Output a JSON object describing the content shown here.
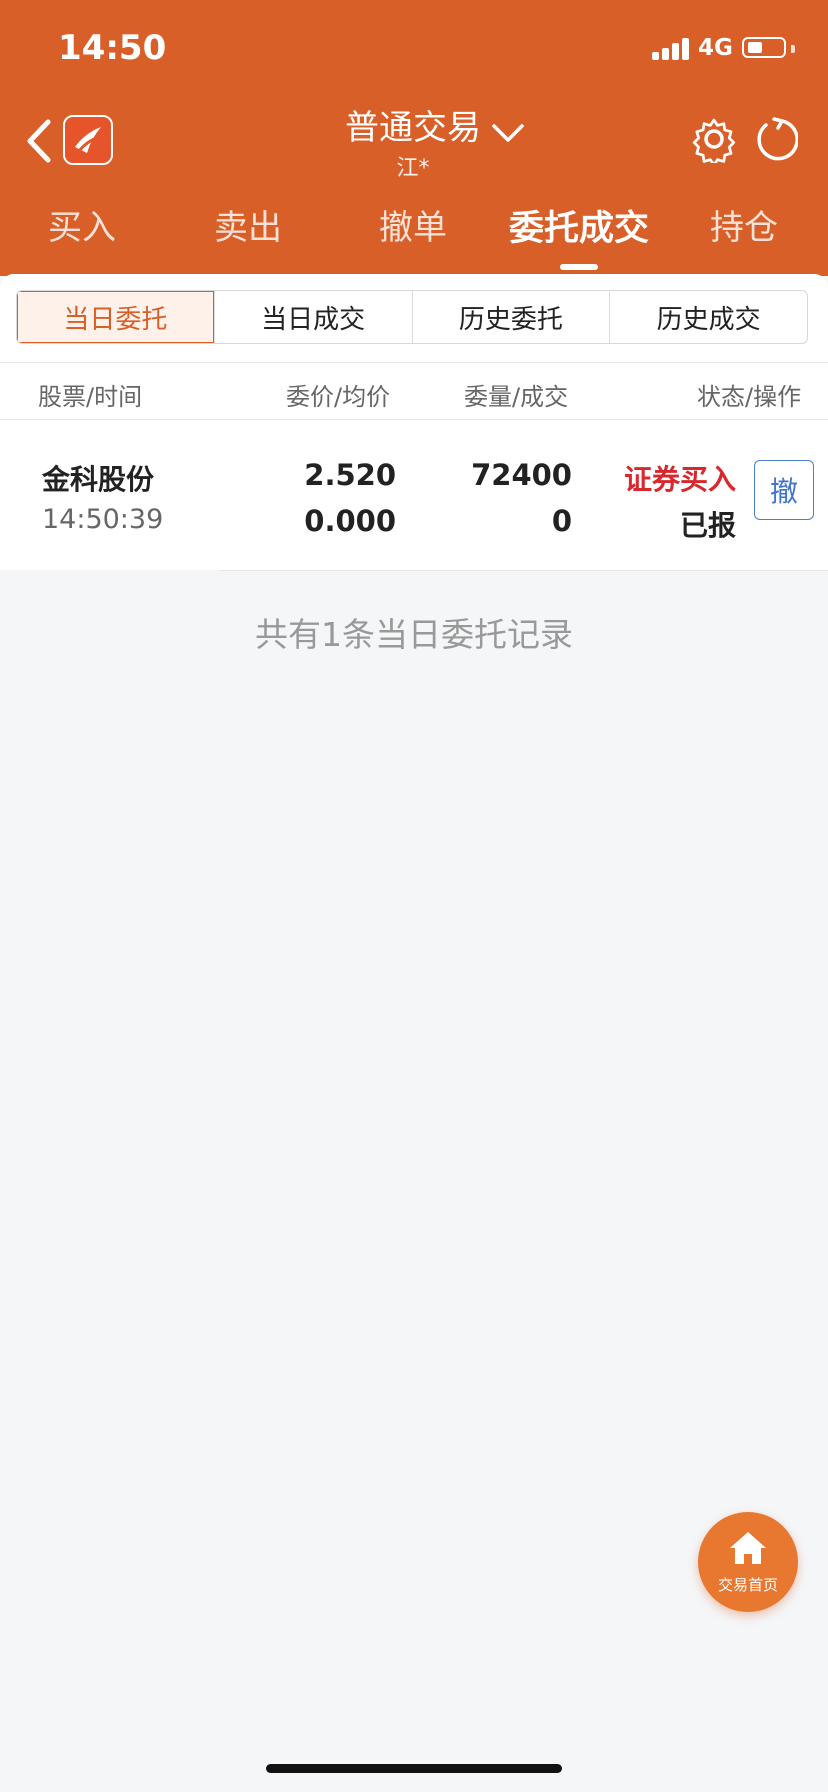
{
  "status_bar": {
    "time": "14:50",
    "network": "4G"
  },
  "header": {
    "title": "普通交易",
    "subtitle": "江*",
    "tabs": [
      {
        "label": "买入"
      },
      {
        "label": "卖出"
      },
      {
        "label": "撤单"
      },
      {
        "label": "委托成交",
        "active": true
      },
      {
        "label": "持仓"
      }
    ]
  },
  "segments": [
    {
      "label": "当日委托",
      "active": true
    },
    {
      "label": "当日成交"
    },
    {
      "label": "历史委托"
    },
    {
      "label": "历史成交"
    }
  ],
  "columns": {
    "col1": "股票/时间",
    "col2": "委价/均价",
    "col3": "委量/成交",
    "col4": "状态/操作"
  },
  "orders": [
    {
      "name": "金科股份",
      "time": "14:50:39",
      "price": "2.520",
      "avg_price": "0.000",
      "quantity": "72400",
      "filled": "0",
      "direction": "证券买入",
      "status": "已报",
      "action": "撤"
    }
  ],
  "summary": "共有1条当日委托记录",
  "fab": {
    "label": "交易首页"
  },
  "colors": {
    "brand": "#d95f29",
    "buy_red": "#d8282d",
    "action_blue": "#3e76cc"
  }
}
